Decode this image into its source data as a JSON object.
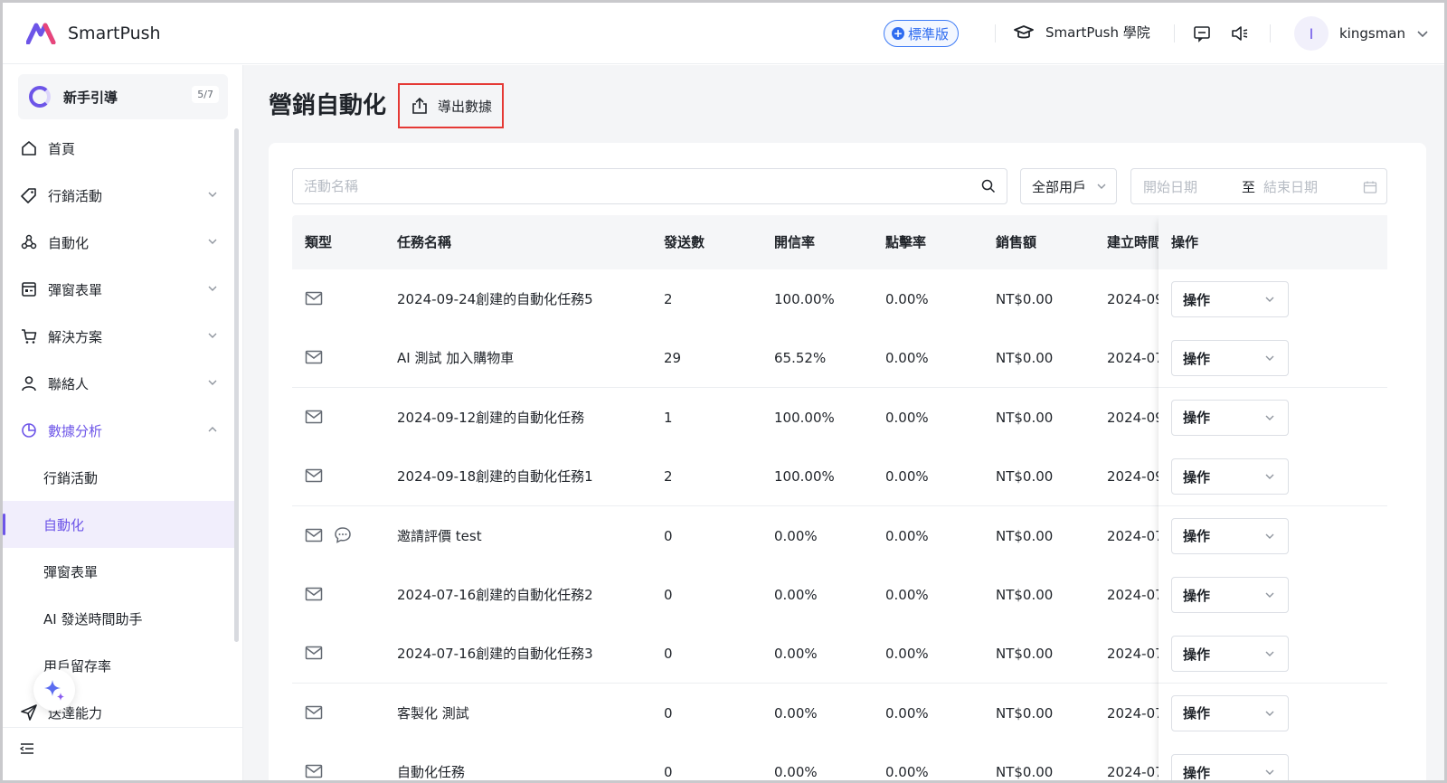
{
  "header": {
    "app_name": "SmartPush",
    "plan_badge": "標準版",
    "academy_label": "SmartPush 學院",
    "user": {
      "avatar_initial": "I",
      "name": "kingsman"
    }
  },
  "sidebar": {
    "guide": {
      "label": "新手引導",
      "count": "5/7"
    },
    "items": [
      {
        "label": "首頁",
        "icon": "home-icon"
      },
      {
        "label": "行銷活動",
        "icon": "tag-icon"
      },
      {
        "label": "自動化",
        "icon": "automation-icon"
      },
      {
        "label": "彈窗表單",
        "icon": "form-icon"
      },
      {
        "label": "解決方案",
        "icon": "cart-icon"
      },
      {
        "label": "聯絡人",
        "icon": "user-icon"
      },
      {
        "label": "數據分析",
        "icon": "chart-pie-icon"
      }
    ],
    "sub_items": [
      {
        "label": "行銷活動"
      },
      {
        "label": "自動化"
      },
      {
        "label": "彈窗表單"
      },
      {
        "label": "AI 發送時間助手"
      },
      {
        "label": "用戶留存率"
      }
    ],
    "last_item": {
      "label": "送達能力",
      "icon": "send-icon"
    }
  },
  "main": {
    "title": "營銷自動化",
    "export_label": "導出數據",
    "search_placeholder": "活動名稱",
    "filter_label": "全部用戶",
    "date_start_placeholder": "開始日期",
    "date_sep": "至",
    "date_end_placeholder": "結束日期",
    "columns": [
      "類型",
      "任務名稱",
      "發送數",
      "開信率",
      "點擊率",
      "銷售額",
      "建立時間",
      "操作"
    ],
    "rows": [
      {
        "name": "2024-09-24創建的自動化任務5",
        "sent": "2",
        "open": "100.00%",
        "click": "0.00%",
        "sales": "NT$0.00",
        "created": "2024-09",
        "action": "操作",
        "sms": false
      },
      {
        "name": "AI 測試 加入購物車",
        "sent": "29",
        "open": "65.52%",
        "click": "0.00%",
        "sales": "NT$0.00",
        "created": "2024-07",
        "action": "操作",
        "sms": false
      },
      {
        "name": "2024-09-12創建的自動化任務",
        "sent": "1",
        "open": "100.00%",
        "click": "0.00%",
        "sales": "NT$0.00",
        "created": "2024-09",
        "action": "操作",
        "sms": false
      },
      {
        "name": "2024-09-18創建的自動化任務1",
        "sent": "2",
        "open": "100.00%",
        "click": "0.00%",
        "sales": "NT$0.00",
        "created": "2024-09",
        "action": "操作",
        "sms": false
      },
      {
        "name": "邀請評價 test",
        "sent": "0",
        "open": "0.00%",
        "click": "0.00%",
        "sales": "NT$0.00",
        "created": "2024-07",
        "action": "操作",
        "sms": true
      },
      {
        "name": "2024-07-16創建的自動化任務2",
        "sent": "0",
        "open": "0.00%",
        "click": "0.00%",
        "sales": "NT$0.00",
        "created": "2024-07",
        "action": "操作",
        "sms": false
      },
      {
        "name": "2024-07-16創建的自動化任務3",
        "sent": "0",
        "open": "0.00%",
        "click": "0.00%",
        "sales": "NT$0.00",
        "created": "2024-07",
        "action": "操作",
        "sms": false
      },
      {
        "name": "客製化 測試",
        "sent": "0",
        "open": "0.00%",
        "click": "0.00%",
        "sales": "NT$0.00",
        "created": "2024-07",
        "action": "操作",
        "sms": false
      },
      {
        "name": "自動化任務",
        "sent": "0",
        "open": "0.00%",
        "click": "0.00%",
        "sales": "NT$0.00",
        "created": "2024-07",
        "action": "操作",
        "sms": false
      }
    ]
  },
  "colors": {
    "accent": "#6d55e8",
    "badge_blue": "#2f6cf0",
    "highlight_red": "#e53935"
  }
}
